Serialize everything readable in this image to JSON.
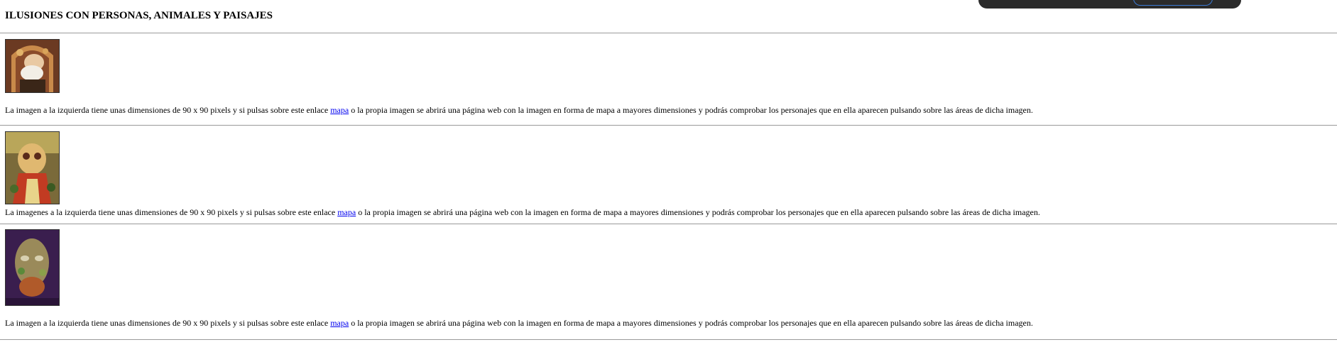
{
  "page": {
    "title": "ILUSIONES CON PERSONAS, ANIMALES Y PAISAJES"
  },
  "items": [
    {
      "text_before": "La imagen a la izquierda tiene unas dimensiones de 90 x 90 pixels y si pulsas sobre este enlace ",
      "link": "mapa",
      "text_after": " o la propia imagen se abrirá una página web con la imagen en forma de mapa a mayores dimensiones y podrás comprobar los personajes que en ella aparecen pulsando sobre las áreas de dicha imagen."
    },
    {
      "text_before": "La imagenes a la izquierda tiene unas dimensiones de 90 x 90 pixels y si pulsas sobre este enlace ",
      "link": "mapa",
      "text_after": " o la propia imagen se abrirá una página web con la imagen en forma de mapa a mayores dimensiones y podrás comprobar los personajes que en ella aparecen pulsando sobre las áreas de dicha imagen."
    },
    {
      "text_before": "La imagen a la izquierda tiene unas dimensiones de 90 x 90 pixels y si pulsas sobre este enlace ",
      "link": "mapa",
      "text_after": " o la propia imagen se abrirá una página web con la imagen en forma de mapa a mayores dimensiones y podrás comprobar los personajes que en ella aparecen pulsando sobre las áreas de dicha imagen."
    }
  ]
}
